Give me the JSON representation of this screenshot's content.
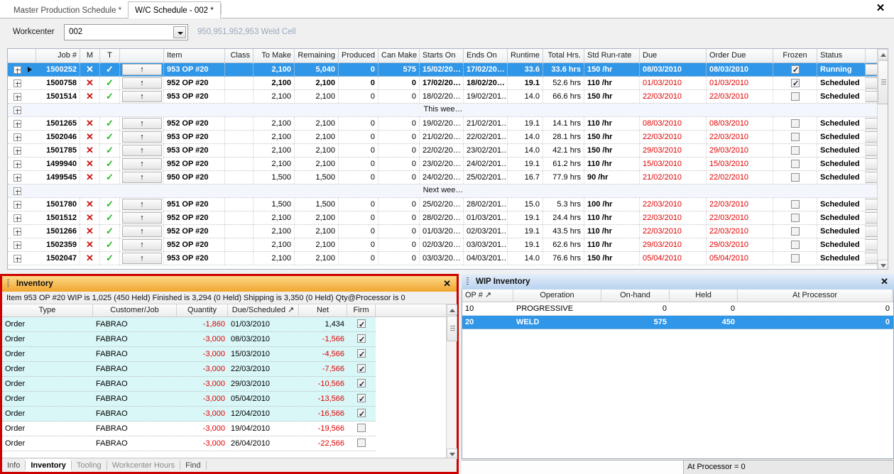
{
  "window": {
    "close_label": "✕",
    "tabs": [
      {
        "label": "Master Production Schedule *",
        "active": false
      },
      {
        "label": "W/C Schedule - 002 *",
        "active": true
      }
    ]
  },
  "toolbar": {
    "workcenter_label": "Workcenter",
    "workcenter_value": "002",
    "workcenter_description": "950,951,952,953 Weld Cell"
  },
  "schedule_grid": {
    "columns": [
      "Job #",
      "M",
      "T",
      "",
      "Item",
      "Class",
      "To Make",
      "Remaining",
      "Produced",
      "Can Make",
      "Starts On",
      "Ends On",
      "Runtime",
      "Total Hrs.",
      "Std Run-rate",
      "Due",
      "Order Due",
      "Frozen",
      "Status",
      ""
    ],
    "rows": [
      {
        "kind": "data",
        "selected": true,
        "marker": true,
        "job": "1500252",
        "m": "✕",
        "t": "✓",
        "up": "↑",
        "item": "953 OP #20",
        "class": "",
        "to_make": "2,100",
        "remaining": "5,040",
        "produced": "0",
        "can_make": "575",
        "starts_on": "15/02/20…",
        "ends_on": "17/02/20…",
        "runtime": "33.6",
        "total_hrs": "33.6 hrs",
        "std_run_rate": "150 /hr",
        "due": "08/03/2010",
        "due_red": false,
        "order_due": "08/03/2010",
        "order_due_red": false,
        "frozen": true,
        "status": "Running",
        "down": "↓"
      },
      {
        "kind": "data",
        "selected": false,
        "marker": false,
        "job": "1500758",
        "m": "✕",
        "t": "✓",
        "up": "↑",
        "item": "952 OP #20",
        "class": "",
        "to_make": "2,100",
        "remaining": "2,100",
        "produced": "0",
        "can_make": "0",
        "starts_on": "17/02/20…",
        "ends_on": "18/02/20…",
        "runtime": "19.1",
        "total_hrs": "52.6 hrs",
        "std_run_rate": "110 /hr",
        "due": "01/03/2010",
        "due_red": true,
        "order_due": "01/03/2010",
        "order_due_red": true,
        "frozen": true,
        "status": "Scheduled",
        "bold": true,
        "down": "↓"
      },
      {
        "kind": "data",
        "selected": false,
        "marker": false,
        "job": "1501514",
        "m": "✕",
        "t": "✓",
        "up": "↑",
        "item": "953 OP #20",
        "class": "",
        "to_make": "2,100",
        "remaining": "2,100",
        "produced": "0",
        "can_make": "0",
        "starts_on": "18/02/20…",
        "ends_on": "19/02/201…",
        "runtime": "14.0",
        "total_hrs": "66.6 hrs",
        "std_run_rate": "150 /hr",
        "due": "22/03/2010",
        "due_red": true,
        "order_due": "22/03/2010",
        "order_due_red": true,
        "frozen": false,
        "status": "Scheduled",
        "down": "↓"
      },
      {
        "kind": "group",
        "caption": "This wee…"
      },
      {
        "kind": "data",
        "selected": false,
        "marker": false,
        "job": "1501265",
        "m": "✕",
        "t": "✓",
        "up": "↑",
        "item": "952 OP #20",
        "class": "",
        "to_make": "2,100",
        "remaining": "2,100",
        "produced": "0",
        "can_make": "0",
        "starts_on": "19/02/20…",
        "ends_on": "21/02/201…",
        "runtime": "19.1",
        "total_hrs": "14.1 hrs",
        "std_run_rate": "110 /hr",
        "due": "08/03/2010",
        "due_red": true,
        "order_due": "08/03/2010",
        "order_due_red": true,
        "frozen": false,
        "status": "Scheduled",
        "down": "↓"
      },
      {
        "kind": "data",
        "selected": false,
        "marker": false,
        "job": "1502046",
        "m": "✕",
        "t": "✓",
        "up": "↑",
        "item": "953 OP #20",
        "class": "",
        "to_make": "2,100",
        "remaining": "2,100",
        "produced": "0",
        "can_make": "0",
        "starts_on": "21/02/20…",
        "ends_on": "22/02/201…",
        "runtime": "14.0",
        "total_hrs": "28.1 hrs",
        "std_run_rate": "150 /hr",
        "due": "22/03/2010",
        "due_red": true,
        "order_due": "22/03/2010",
        "order_due_red": true,
        "frozen": false,
        "status": "Scheduled",
        "down": "↓"
      },
      {
        "kind": "data",
        "selected": false,
        "marker": false,
        "job": "1501785",
        "m": "✕",
        "t": "✓",
        "up": "↑",
        "item": "953 OP #20",
        "class": "",
        "to_make": "2,100",
        "remaining": "2,100",
        "produced": "0",
        "can_make": "0",
        "starts_on": "22/02/20…",
        "ends_on": "23/02/201…",
        "runtime": "14.0",
        "total_hrs": "42.1 hrs",
        "std_run_rate": "150 /hr",
        "due": "29/03/2010",
        "due_red": true,
        "order_due": "29/03/2010",
        "order_due_red": true,
        "frozen": false,
        "status": "Scheduled",
        "down": "↓"
      },
      {
        "kind": "data",
        "selected": false,
        "marker": false,
        "job": "1499940",
        "m": "✕",
        "t": "✓",
        "up": "↑",
        "item": "952 OP #20",
        "class": "",
        "to_make": "2,100",
        "remaining": "2,100",
        "produced": "0",
        "can_make": "0",
        "starts_on": "23/02/20…",
        "ends_on": "24/02/201…",
        "runtime": "19.1",
        "total_hrs": "61.2 hrs",
        "std_run_rate": "110 /hr",
        "due": "15/03/2010",
        "due_red": true,
        "order_due": "15/03/2010",
        "order_due_red": true,
        "frozen": false,
        "status": "Scheduled",
        "down": "↓"
      },
      {
        "kind": "data",
        "selected": false,
        "marker": false,
        "job": "1499545",
        "m": "✕",
        "t": "✓",
        "up": "↑",
        "item": "950 OP #20",
        "class": "",
        "to_make": "1,500",
        "remaining": "1,500",
        "produced": "0",
        "can_make": "0",
        "starts_on": "24/02/20…",
        "ends_on": "25/02/201…",
        "runtime": "16.7",
        "total_hrs": "77.9 hrs",
        "std_run_rate": "90 /hr",
        "due": "21/02/2010",
        "due_red": true,
        "order_due": "22/02/2010",
        "order_due_red": true,
        "frozen": false,
        "status": "Scheduled",
        "down": "↓"
      },
      {
        "kind": "group",
        "caption": "Next wee…"
      },
      {
        "kind": "data",
        "selected": false,
        "marker": false,
        "job": "1501780",
        "m": "✕",
        "t": "✓",
        "up": "↑",
        "item": "951 OP #20",
        "class": "",
        "to_make": "1,500",
        "remaining": "1,500",
        "produced": "0",
        "can_make": "0",
        "starts_on": "25/02/20…",
        "ends_on": "28/02/201…",
        "runtime": "15.0",
        "total_hrs": "5.3 hrs",
        "std_run_rate": "100 /hr",
        "due": "22/03/2010",
        "due_red": true,
        "order_due": "22/03/2010",
        "order_due_red": true,
        "frozen": false,
        "status": "Scheduled",
        "down": "↓"
      },
      {
        "kind": "data",
        "selected": false,
        "marker": false,
        "job": "1501512",
        "m": "✕",
        "t": "✓",
        "up": "↑",
        "item": "952 OP #20",
        "class": "",
        "to_make": "2,100",
        "remaining": "2,100",
        "produced": "0",
        "can_make": "0",
        "starts_on": "28/02/20…",
        "ends_on": "01/03/201…",
        "runtime": "19.1",
        "total_hrs": "24.4 hrs",
        "std_run_rate": "110 /hr",
        "due": "22/03/2010",
        "due_red": true,
        "order_due": "22/03/2010",
        "order_due_red": true,
        "frozen": false,
        "status": "Scheduled",
        "down": "↓"
      },
      {
        "kind": "data",
        "selected": false,
        "marker": false,
        "job": "1501266",
        "m": "✕",
        "t": "✓",
        "up": "↑",
        "item": "952 OP #20",
        "class": "",
        "to_make": "2,100",
        "remaining": "2,100",
        "produced": "0",
        "can_make": "0",
        "starts_on": "01/03/20…",
        "ends_on": "02/03/201…",
        "runtime": "19.1",
        "total_hrs": "43.5 hrs",
        "std_run_rate": "110 /hr",
        "due": "22/03/2010",
        "due_red": true,
        "order_due": "22/03/2010",
        "order_due_red": true,
        "frozen": false,
        "status": "Scheduled",
        "down": "↓"
      },
      {
        "kind": "data",
        "selected": false,
        "marker": false,
        "job": "1502359",
        "m": "✕",
        "t": "✓",
        "up": "↑",
        "item": "952 OP #20",
        "class": "",
        "to_make": "2,100",
        "remaining": "2,100",
        "produced": "0",
        "can_make": "0",
        "starts_on": "02/03/20…",
        "ends_on": "03/03/201…",
        "runtime": "19.1",
        "total_hrs": "62.6 hrs",
        "std_run_rate": "110 /hr",
        "due": "29/03/2010",
        "due_red": true,
        "order_due": "29/03/2010",
        "order_due_red": true,
        "frozen": false,
        "status": "Scheduled",
        "down": "↓"
      },
      {
        "kind": "data",
        "selected": false,
        "marker": false,
        "job": "1502047",
        "m": "✕",
        "t": "✓",
        "up": "↑",
        "item": "953 OP #20",
        "class": "",
        "to_make": "2,100",
        "remaining": "2,100",
        "produced": "0",
        "can_make": "0",
        "starts_on": "03/03/20…",
        "ends_on": "04/03/201…",
        "runtime": "14.0",
        "total_hrs": "76.6 hrs",
        "std_run_rate": "150 /hr",
        "due": "05/04/2010",
        "due_red": true,
        "order_due": "05/04/2010",
        "order_due_red": true,
        "frozen": false,
        "status": "Scheduled",
        "down": "↓"
      }
    ]
  },
  "inventory_panel": {
    "title": "Inventory",
    "close_label": "✕",
    "summary": "Item 953 OP #20  WIP is 1,025 (450 Held)  Finished is 3,294 (0 Held)  Shipping is 3,350  (0 Held)  Qty@Processor is 0",
    "columns": [
      "Type",
      "Customer/Job",
      "Quantity",
      "Due/Scheduled ↗",
      "Net",
      "Firm"
    ],
    "rows": [
      {
        "type": "Order",
        "customer": "FABRAO",
        "quantity": "-1,860",
        "due": "01/03/2010",
        "net": "1,434",
        "net_red": false,
        "firm": true,
        "alt": true
      },
      {
        "type": "Order",
        "customer": "FABRAO",
        "quantity": "-3,000",
        "due": "08/03/2010",
        "net": "-1,566",
        "net_red": true,
        "firm": true,
        "alt": true
      },
      {
        "type": "Order",
        "customer": "FABRAO",
        "quantity": "-3,000",
        "due": "15/03/2010",
        "net": "-4,566",
        "net_red": true,
        "firm": true,
        "alt": true
      },
      {
        "type": "Order",
        "customer": "FABRAO",
        "quantity": "-3,000",
        "due": "22/03/2010",
        "net": "-7,566",
        "net_red": true,
        "firm": true,
        "alt": true
      },
      {
        "type": "Order",
        "customer": "FABRAO",
        "quantity": "-3,000",
        "due": "29/03/2010",
        "net": "-10,566",
        "net_red": true,
        "firm": true,
        "alt": true
      },
      {
        "type": "Order",
        "customer": "FABRAO",
        "quantity": "-3,000",
        "due": "05/04/2010",
        "net": "-13,566",
        "net_red": true,
        "firm": true,
        "alt": true
      },
      {
        "type": "Order",
        "customer": "FABRAO",
        "quantity": "-3,000",
        "due": "12/04/2010",
        "net": "-16,566",
        "net_red": true,
        "firm": true,
        "alt": true
      },
      {
        "type": "Order",
        "customer": "FABRAO",
        "quantity": "-3,000",
        "due": "19/04/2010",
        "net": "-19,566",
        "net_red": true,
        "firm": false,
        "alt": false
      },
      {
        "type": "Order",
        "customer": "FABRAO",
        "quantity": "-3,000",
        "due": "26/04/2010",
        "net": "-22,566",
        "net_red": true,
        "firm": false,
        "alt": false
      }
    ],
    "bottom_tabs": [
      {
        "label": "Info",
        "active": false,
        "enabled": true
      },
      {
        "label": "Inventory",
        "active": true,
        "enabled": true
      },
      {
        "label": "Tooling",
        "active": false,
        "enabled": false
      },
      {
        "label": "Workcenter Hours",
        "active": false,
        "enabled": false
      },
      {
        "label": "Find",
        "active": false,
        "enabled": true
      }
    ]
  },
  "wip_panel": {
    "title": "WIP Inventory",
    "close_label": "✕",
    "columns": [
      "OP #  ↗",
      "Operation",
      "On-hand",
      "Held",
      "At Processor"
    ],
    "rows": [
      {
        "op": "10",
        "operation": "PROGRESSIVE",
        "on_hand": "0",
        "held": "0",
        "at_processor": "0",
        "selected": false
      },
      {
        "op": "20",
        "operation": "WELD",
        "on_hand": "575",
        "held": "450",
        "at_processor": "0",
        "selected": true
      }
    ],
    "status": "At Processor = 0"
  },
  "colors": {
    "selection_blue": "#2f96e8",
    "panel_orange": "#f0a52e",
    "panel_blue": "#b8d2ef",
    "red_border": "#cc0000",
    "overdue_red": "#e00000",
    "alt_row_cyan": "#d9f7f7"
  }
}
